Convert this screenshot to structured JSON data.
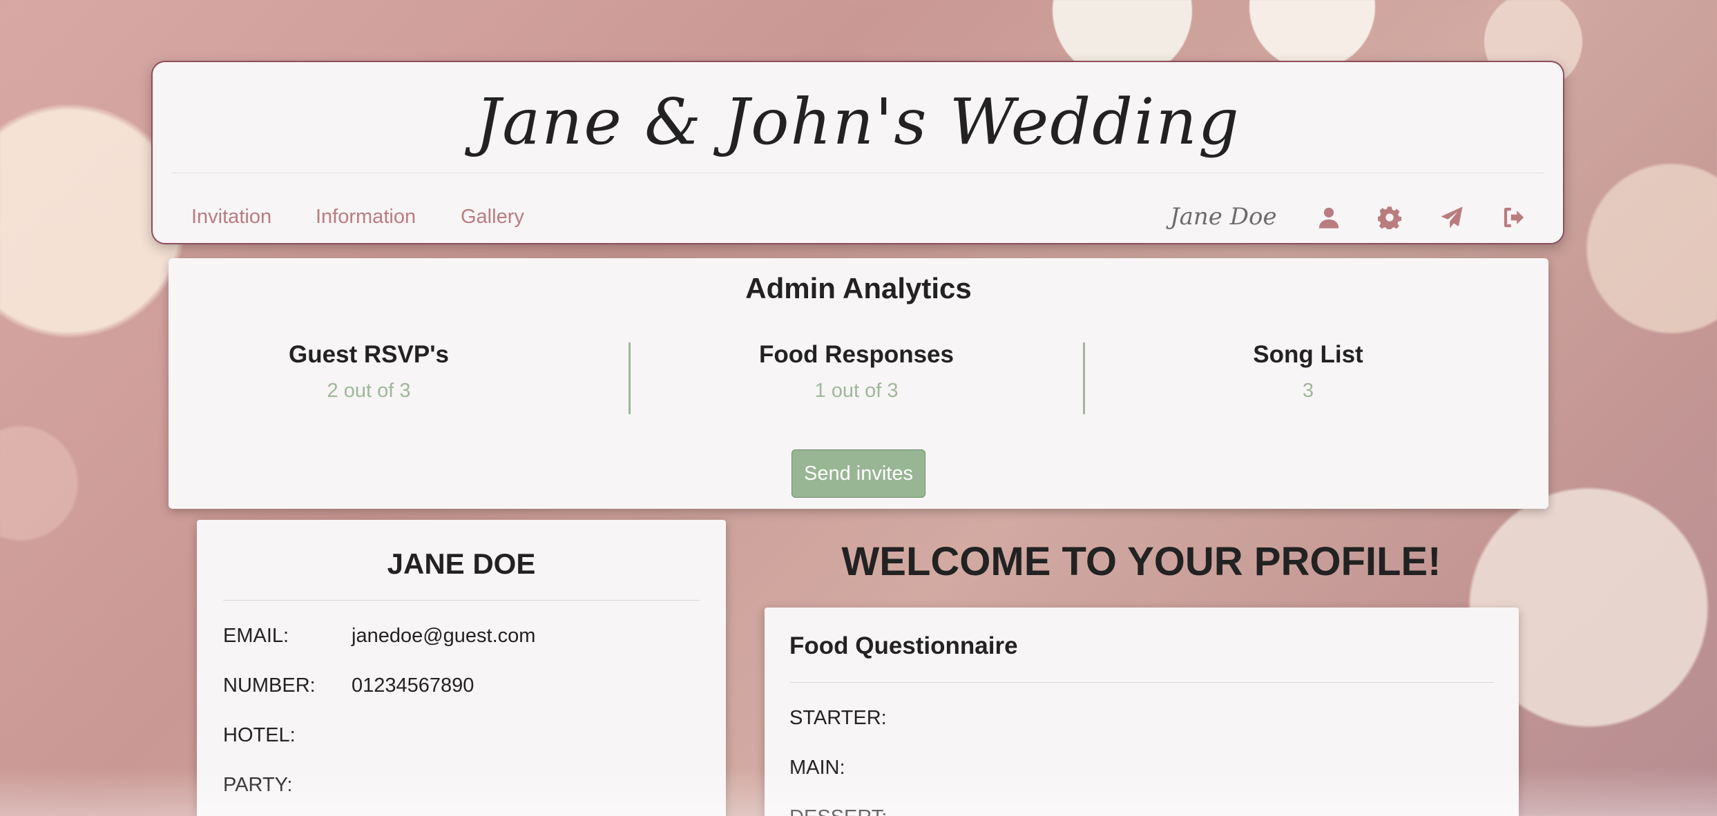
{
  "header": {
    "title": "Jane & John's Wedding",
    "nav": [
      "Invitation",
      "Information",
      "Gallery"
    ],
    "user_name": "Jane Doe",
    "icons": [
      "user-icon",
      "gear-icon",
      "paper-plane-icon",
      "sign-out-icon"
    ]
  },
  "analytics": {
    "title": "Admin Analytics",
    "stats": [
      {
        "label": "Guest RSVP's",
        "value": "2 out of 3"
      },
      {
        "label": "Food Responses",
        "value": "1 out of 3"
      },
      {
        "label": "Song List",
        "value": "3"
      }
    ],
    "send_button": "Send invites"
  },
  "profile": {
    "name": "JANE DOE",
    "fields": [
      {
        "label": "EMAIL:",
        "value": "janedoe@guest.com"
      },
      {
        "label": "NUMBER:",
        "value": "01234567890"
      },
      {
        "label": "HOTEL:",
        "value": ""
      },
      {
        "label": "PARTY:",
        "value": ""
      }
    ]
  },
  "welcome": "WELCOME TO YOUR PROFILE!",
  "food": {
    "title": "Food Questionnaire",
    "fields": [
      "STARTER:",
      "MAIN:",
      "DESSERT:"
    ]
  },
  "colors": {
    "accent_rose": "#b97c7f",
    "accent_green": "#9fb79b",
    "button_green": "#98b594",
    "card_bg": "#f8f5f6"
  }
}
